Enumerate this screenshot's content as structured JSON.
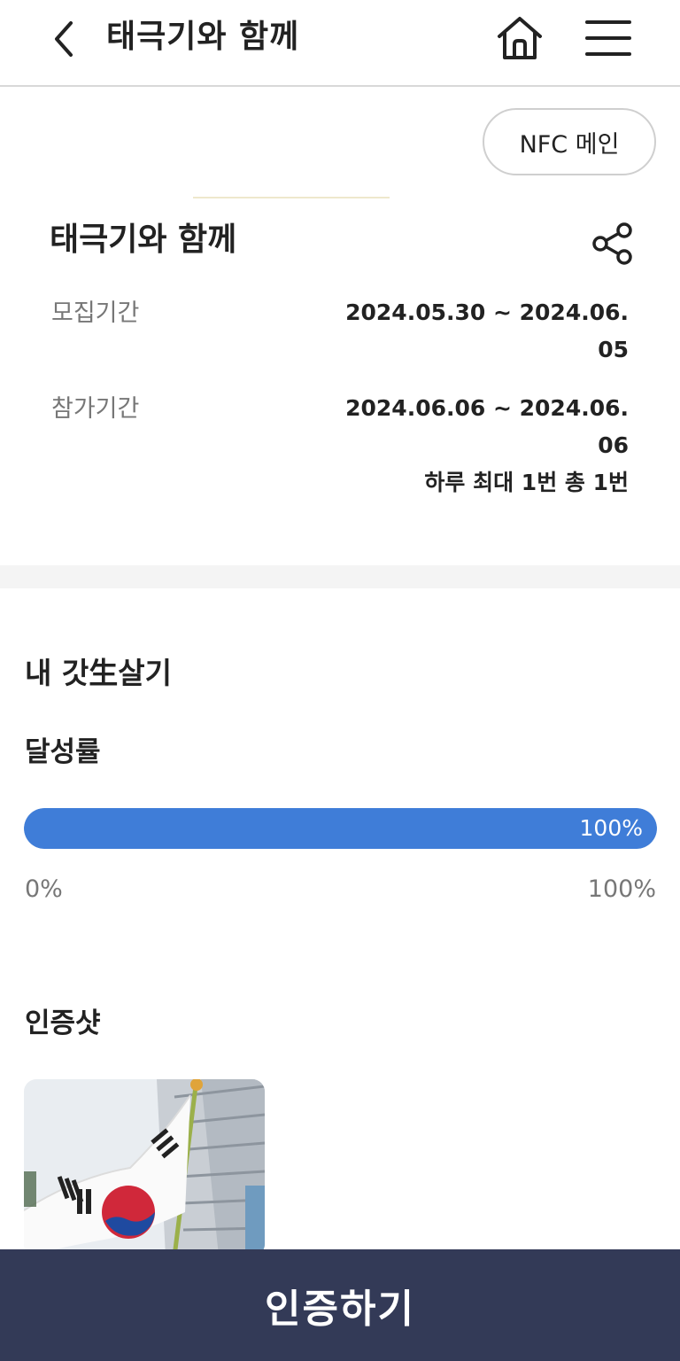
{
  "header": {
    "title": "태극기와 함께",
    "back_icon": "chevron-left-icon",
    "home_icon": "home-icon",
    "menu_icon": "hamburger-menu-icon"
  },
  "nfc_button": {
    "label": "NFC 메인"
  },
  "event": {
    "title": "태극기와 함께",
    "share_icon": "share-icon",
    "recruit": {
      "label": "모집기간",
      "value": "2024.05.30 ~ 2024.06.05"
    },
    "participate": {
      "label": "참가기간",
      "value": "2024.06.06 ~ 2024.06.06",
      "limit": "하루 최대 1번 총 1번"
    }
  },
  "my_section": {
    "title": "내 갓生살기",
    "achievement": {
      "title": "달성률",
      "percent": 100,
      "percent_label": "100%",
      "scale_min": "0%",
      "scale_max": "100%",
      "color": "#3f7dd8"
    },
    "proof_shots": {
      "title": "인증샷"
    }
  },
  "cta": {
    "label": "인증하기",
    "color": "#333a57"
  }
}
